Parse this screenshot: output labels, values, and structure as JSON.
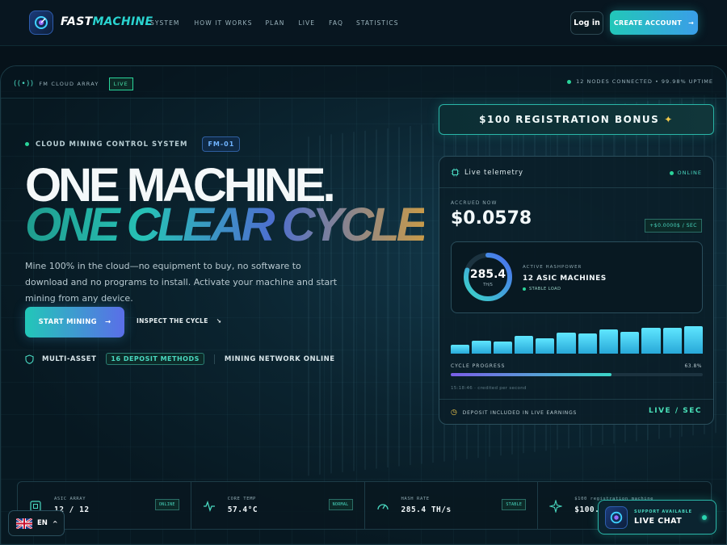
{
  "header": {
    "brand_part1": "FAST",
    "brand_part2": "MACHINE",
    "nav": [
      "SYSTEM",
      "HOW IT WORKS",
      "PLAN",
      "LIVE",
      "FAQ",
      "STATISTICS"
    ],
    "login_label": "Log in",
    "create_label": "CREATE ACCOUNT"
  },
  "topbar": {
    "array_label": "FM CLOUD ARRAY",
    "live_badge": "LIVE",
    "status_text": "12 NODES CONNECTED • 99.98% UPTIME"
  },
  "hero": {
    "kicker": "CLOUD MINING CONTROL SYSTEM",
    "model_badge": "FM-01",
    "headline_1": "ONE MACHINE.",
    "headline_2": "ONE CLEAR CYCLE",
    "subtitle": "Mine 100% in the cloud—no equipment to buy, no software to download and no programs to install. Activate your machine and start mining from any device.",
    "start_label": "START MINING",
    "inspect_label": "INSPECT THE CYCLE",
    "trust_1": "MULTI-ASSET",
    "deposit_badge": "16 DEPOSIT METHODS",
    "trust_2": "MINING NETWORK ONLINE"
  },
  "bonus": {
    "label": "$100 REGISTRATION BONUS"
  },
  "telemetry": {
    "title": "Live telemetry",
    "status": "ONLINE",
    "accrued_label": "ACCRUED NOW",
    "accrued_value": "$0.0578",
    "rate": "+$0.0000$ / SEC",
    "ring_value": "285.4",
    "ring_unit": "TH/S",
    "ring_fraction": 0.8,
    "hashpower_label": "ACTIVE HASHPOWER",
    "hashpower_value": "12 ASIC MACHINES",
    "load_status": "STABLE LOAD",
    "bar_levels": [
      0.3,
      0.45,
      0.42,
      0.6,
      0.52,
      0.72,
      0.7,
      0.82,
      0.75,
      0.9,
      0.88,
      0.95
    ],
    "cycle_label": "CYCLE PROGRESS",
    "cycle_value": "63.8%",
    "cycle_fraction": 0.638,
    "credit_note": "15:18:46 · credited per second",
    "deposit_note": "DEPOSIT INCLUDED IN LIVE EARNINGS",
    "live_sec": "LIVE / SEC"
  },
  "stats": [
    {
      "label": "ASIC ARRAY",
      "value": "12 / 12",
      "badge": "ONLINE",
      "icon": "chip-icon"
    },
    {
      "label": "CORE TEMP",
      "value": "57.4°C",
      "badge": "NORMAL",
      "icon": "pulse-icon"
    },
    {
      "label": "HASH RATE",
      "value": "285.4 TH/s",
      "badge": "STABLE",
      "icon": "gauge-icon"
    },
    {
      "label": "$100 registration machine",
      "value": "$100.0",
      "badge": "",
      "icon": "sparkle-icon"
    }
  ],
  "lang": {
    "code": "EN"
  },
  "chat": {
    "support": "SUPPORT AVAILABLE",
    "label": "LIVE CHAT"
  },
  "colors": {
    "accent": "#2ad4d0",
    "accent2": "#3a9ee8",
    "ok": "#49d8c0"
  }
}
